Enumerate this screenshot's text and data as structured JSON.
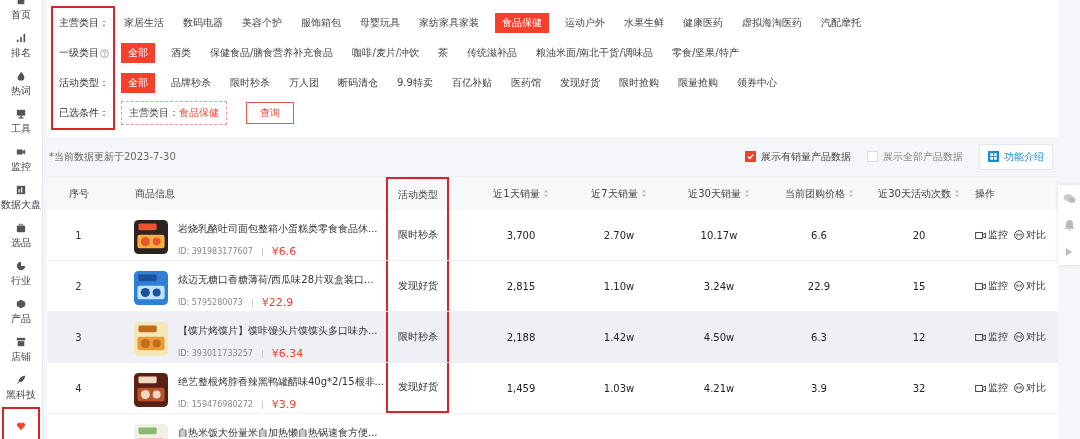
{
  "sidebar": {
    "items": [
      {
        "label": "首页",
        "selected": false,
        "highlighted": false
      },
      {
        "label": "排名",
        "selected": false,
        "highlighted": false
      },
      {
        "label": "热词",
        "selected": false,
        "highlighted": false
      },
      {
        "label": "工具",
        "selected": false,
        "highlighted": false
      },
      {
        "label": "监控",
        "selected": false,
        "highlighted": false
      },
      {
        "label": "数据大盘",
        "selected": false,
        "highlighted": false
      },
      {
        "label": "选品",
        "selected": false,
        "highlighted": false
      },
      {
        "label": "行业",
        "selected": false,
        "highlighted": false
      },
      {
        "label": "产品",
        "selected": false,
        "highlighted": false
      },
      {
        "label": "店铺",
        "selected": false,
        "highlighted": false
      },
      {
        "label": "黑科技",
        "selected": false,
        "highlighted": false
      },
      {
        "selected": true,
        "highlighted": true
      }
    ]
  },
  "filters": {
    "labels_highlighted": true,
    "rows": [
      {
        "kind": "options",
        "label": "主营类目：",
        "help": false,
        "options": [
          {
            "label": "家居生活",
            "selected": false
          },
          {
            "label": "数码电器",
            "selected": false
          },
          {
            "label": "美容个护",
            "selected": false
          },
          {
            "label": "服饰箱包",
            "selected": false
          },
          {
            "label": "母婴玩具",
            "selected": false
          },
          {
            "label": "家纺家具家装",
            "selected": false
          },
          {
            "label": "食品保健",
            "selected": true
          },
          {
            "label": "运动户外",
            "selected": false
          },
          {
            "label": "水果生鲜",
            "selected": false
          },
          {
            "label": "健康医药",
            "selected": false
          },
          {
            "label": "虚拟海淘医药",
            "selected": false
          },
          {
            "label": "汽配摩托",
            "selected": false
          }
        ]
      },
      {
        "kind": "options",
        "label": "一级类目",
        "help": true,
        "options": [
          {
            "label": "全部",
            "selected": true
          },
          {
            "label": "酒类",
            "selected": false
          },
          {
            "label": "保健食品/膳食营养补充食品",
            "selected": false
          },
          {
            "label": "咖啡/麦片/冲饮",
            "selected": false
          },
          {
            "label": "茶",
            "selected": false
          },
          {
            "label": "传统滋补品",
            "selected": false
          },
          {
            "label": "粮油米面/南北干货/调味品",
            "selected": false
          },
          {
            "label": "零食/坚果/特产",
            "selected": false
          }
        ]
      },
      {
        "kind": "options",
        "label": "活动类型：",
        "help": false,
        "options": [
          {
            "label": "全部",
            "selected": true
          },
          {
            "label": "品牌秒杀",
            "selected": false
          },
          {
            "label": "限时秒杀",
            "selected": false
          },
          {
            "label": "万人团",
            "selected": false
          },
          {
            "label": "断码清仓",
            "selected": false
          },
          {
            "label": "9.9特卖",
            "selected": false
          },
          {
            "label": "百亿补贴",
            "selected": false
          },
          {
            "label": "医药馆",
            "selected": false
          },
          {
            "label": "发现好货",
            "selected": false
          },
          {
            "label": "限时抢购",
            "selected": false
          },
          {
            "label": "限量抢购",
            "selected": false
          },
          {
            "label": "领券中心",
            "selected": false
          }
        ]
      },
      {
        "kind": "conditions",
        "label": "已选条件：",
        "help": false,
        "condition": {
          "label": "主营类目：",
          "value": "食品保健"
        },
        "button": "查询"
      }
    ]
  },
  "toolbar": {
    "note": "*当前数据更新于2023-7-30",
    "checkboxes": [
      {
        "label": "展示有销量产品数据",
        "checked": true
      },
      {
        "label": "展示全部产品数据",
        "checked": false
      }
    ],
    "button": "功能介绍"
  },
  "table": {
    "columns": [
      {
        "label": "序号",
        "sortable": false,
        "highlighted": false
      },
      {
        "label": "商品信息",
        "sortable": false,
        "highlighted": false
      },
      {
        "label": "活动类型",
        "sortable": false,
        "highlighted": true
      },
      {
        "label": "近1天销量",
        "sortable": true,
        "highlighted": false
      },
      {
        "label": "近7天销量",
        "sortable": true,
        "highlighted": false
      },
      {
        "label": "近30天销量",
        "sortable": true,
        "highlighted": false
      },
      {
        "label": "当前团购价格",
        "sortable": true,
        "highlighted": false
      },
      {
        "label": "近30天活动次数",
        "sortable": true,
        "highlighted": false
      },
      {
        "label": "操作",
        "sortable": false,
        "highlighted": false
      }
    ],
    "rows": [
      {
        "index": "1",
        "title": "岩烧乳酪吐司面包整箱小蛋糕类零食食品休...",
        "id": "ID: 391983177607",
        "price": "¥6.6",
        "activity": "限时秒杀",
        "sales_1d": "3,700",
        "sales_7d": "2.70w",
        "sales_30d": "10.17w",
        "group_price": "6.6",
        "activity_count": "20",
        "actions": [
          "监控",
          "对比"
        ],
        "hovered": false
      },
      {
        "index": "2",
        "title": "炫迈无糖口香糖薄荷/西瓜味28片双盒装口...",
        "id": "ID: 5795280073",
        "price": "¥22.9",
        "activity": "发现好货",
        "sales_1d": "2,815",
        "sales_7d": "1.10w",
        "sales_30d": "3.24w",
        "group_price": "22.9",
        "activity_count": "15",
        "actions": [
          "监控",
          "对比"
        ],
        "hovered": false
      },
      {
        "index": "3",
        "title": "【馍片烤馍片】馍咔馒头片馍馍头多口味办...",
        "id": "ID: 393011733257",
        "price": "¥6.34",
        "activity": "限时秒杀",
        "sales_1d": "2,188",
        "sales_7d": "1.42w",
        "sales_30d": "4.50w",
        "group_price": "6.3",
        "activity_count": "12",
        "actions": [
          "监控",
          "对比"
        ],
        "hovered": true
      },
      {
        "index": "4",
        "title": "绝艺整根烤脖香辣黑鸭罐醋味40g*2/15根非...",
        "id": "ID: 159476980272",
        "price": "¥3.9",
        "activity": "发现好货",
        "sales_1d": "1,459",
        "sales_7d": "1.03w",
        "sales_30d": "4.21w",
        "group_price": "3.9",
        "activity_count": "32",
        "actions": [
          "监控",
          "对比"
        ],
        "hovered": false
      },
      {
        "title": "自热米饭大份量米自加热懒自热锅速食方便..."
      }
    ]
  }
}
